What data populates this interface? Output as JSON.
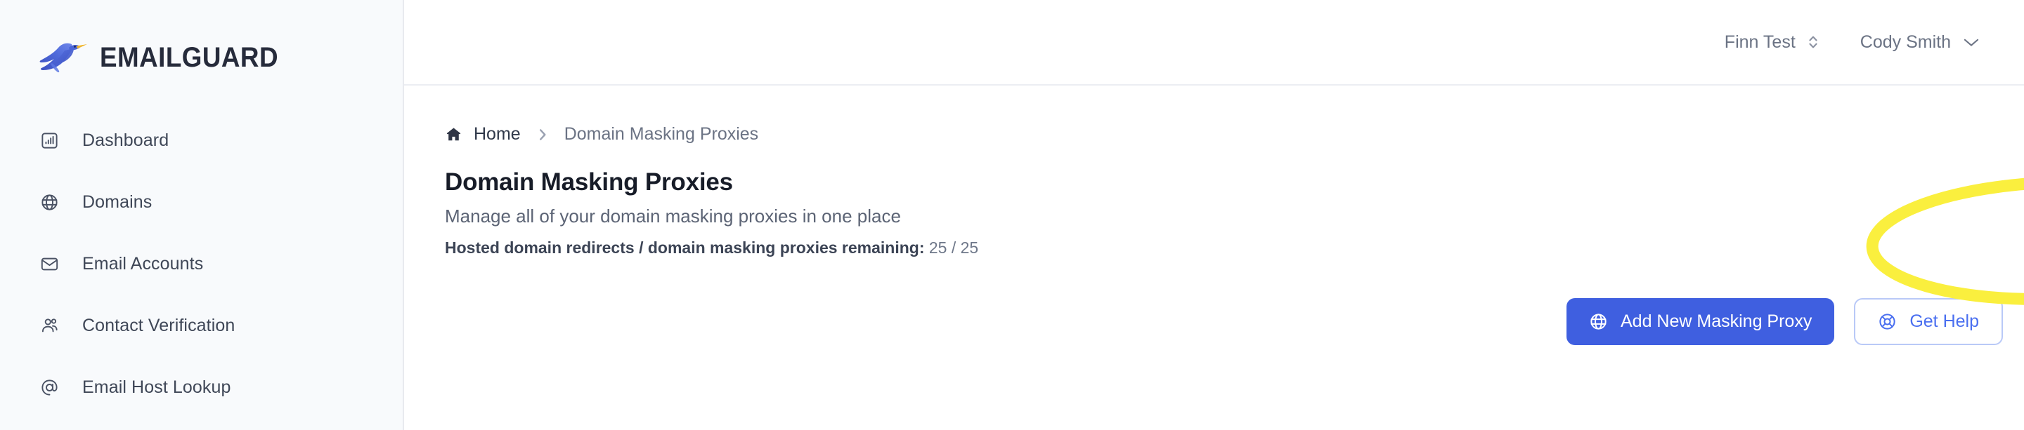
{
  "brand": {
    "name": "EMAILGUARD",
    "logo_icon": "bird-logo-icon",
    "accent_blue": "#3f5fe0",
    "logo_bird_blue": "#4a64d8",
    "logo_beak_yellow": "#f0b429"
  },
  "sidebar": {
    "items": [
      {
        "label": "Dashboard",
        "icon": "chart-bar-box-icon"
      },
      {
        "label": "Domains",
        "icon": "globe-icon"
      },
      {
        "label": "Email Accounts",
        "icon": "envelope-icon"
      },
      {
        "label": "Contact Verification",
        "icon": "users-icon"
      },
      {
        "label": "Email Host Lookup",
        "icon": "at-sign-circle-icon"
      }
    ]
  },
  "topbar": {
    "workspace": "Finn Test",
    "workspace_icon": "chevron-up-down-icon",
    "user": "Cody Smith",
    "user_icon": "chevron-down-icon"
  },
  "breadcrumb": {
    "home_icon": "home-icon",
    "home": "Home",
    "separator_icon": "chevron-right-icon",
    "current": "Domain Masking Proxies"
  },
  "page": {
    "title": "Domain Masking Proxies",
    "subtitle": "Manage all of your domain masking proxies in one place",
    "quota_label": "Hosted domain redirects / domain masking proxies remaining:",
    "quota_value": "25 / 25"
  },
  "actions": {
    "primary_label": "Add New Masking Proxy",
    "primary_icon": "globe-icon",
    "secondary_label": "Get Help",
    "secondary_icon": "lifebuoy-icon"
  },
  "annotation": {
    "shape": "ellipse-highlight",
    "color": "#FAEF3E",
    "target": "Add New Masking Proxy"
  }
}
